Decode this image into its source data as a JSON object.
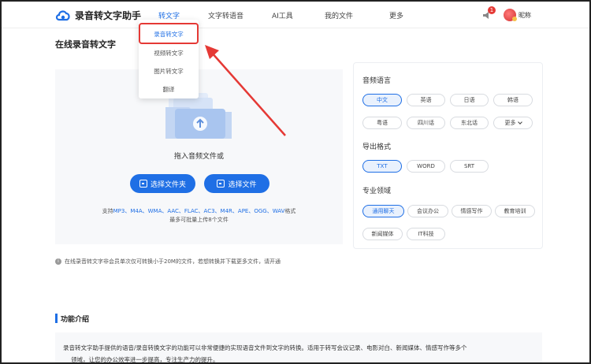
{
  "brand": {
    "name": "录音转文字助手"
  },
  "nav": {
    "items": [
      "转文字",
      "文字转语音",
      "AI工具",
      "我的文件",
      "更多"
    ],
    "active_index": 0
  },
  "header": {
    "notification_count": "1",
    "nickname": "昵称"
  },
  "dropdown": {
    "items": [
      "录音转文字",
      "视频转文字",
      "图片转文字",
      "翻译"
    ],
    "active_index": 0
  },
  "page": {
    "title": "在线录音转文字"
  },
  "upload": {
    "drop_text": "拖入音频文件或",
    "select_folder": "选择文件夹",
    "select_file": "选择文件",
    "formats_prefix": "支持",
    "formats_list": "MP3、M4A、WMA、AAC、FLAC、AC3、M4R、APE、OGG、WAV",
    "formats_suffix": "格式",
    "limit": "最多可批量上传8个文件"
  },
  "settings": {
    "language": {
      "title": "音频语言",
      "options": [
        "中文",
        "英语",
        "日语",
        "韩语",
        "粤语",
        "四川话",
        "东北话",
        "更多"
      ],
      "selected_index": 0
    },
    "format": {
      "title": "导出格式",
      "options": [
        "TXT",
        "WORD",
        "SRT"
      ],
      "selected_index": 0
    },
    "domain": {
      "title": "专业领域",
      "options": [
        "通用聊天",
        "会议办公",
        "情感写作",
        "教育培训",
        "新闻媒体",
        "IT科技"
      ],
      "selected_index": 0
    }
  },
  "notice": {
    "text": "在线录音转文字非会员单次仅可转换小于20M的文件，若想转换并下载更多文件，请开通"
  },
  "features": {
    "title": "功能介绍",
    "line1": "录音转文字助手提供的语音/录音转换文字的功能可以非常便捷的实现语音文件到文字的转换。适用于转写会议记录、电影对白、新闻媒体、情感写作等多个",
    "line2": "领域，让您的办公效率进一步提高，专注生产力的提升。"
  },
  "colors": {
    "accent": "#1f6fe5",
    "annotation": "#e53935"
  }
}
